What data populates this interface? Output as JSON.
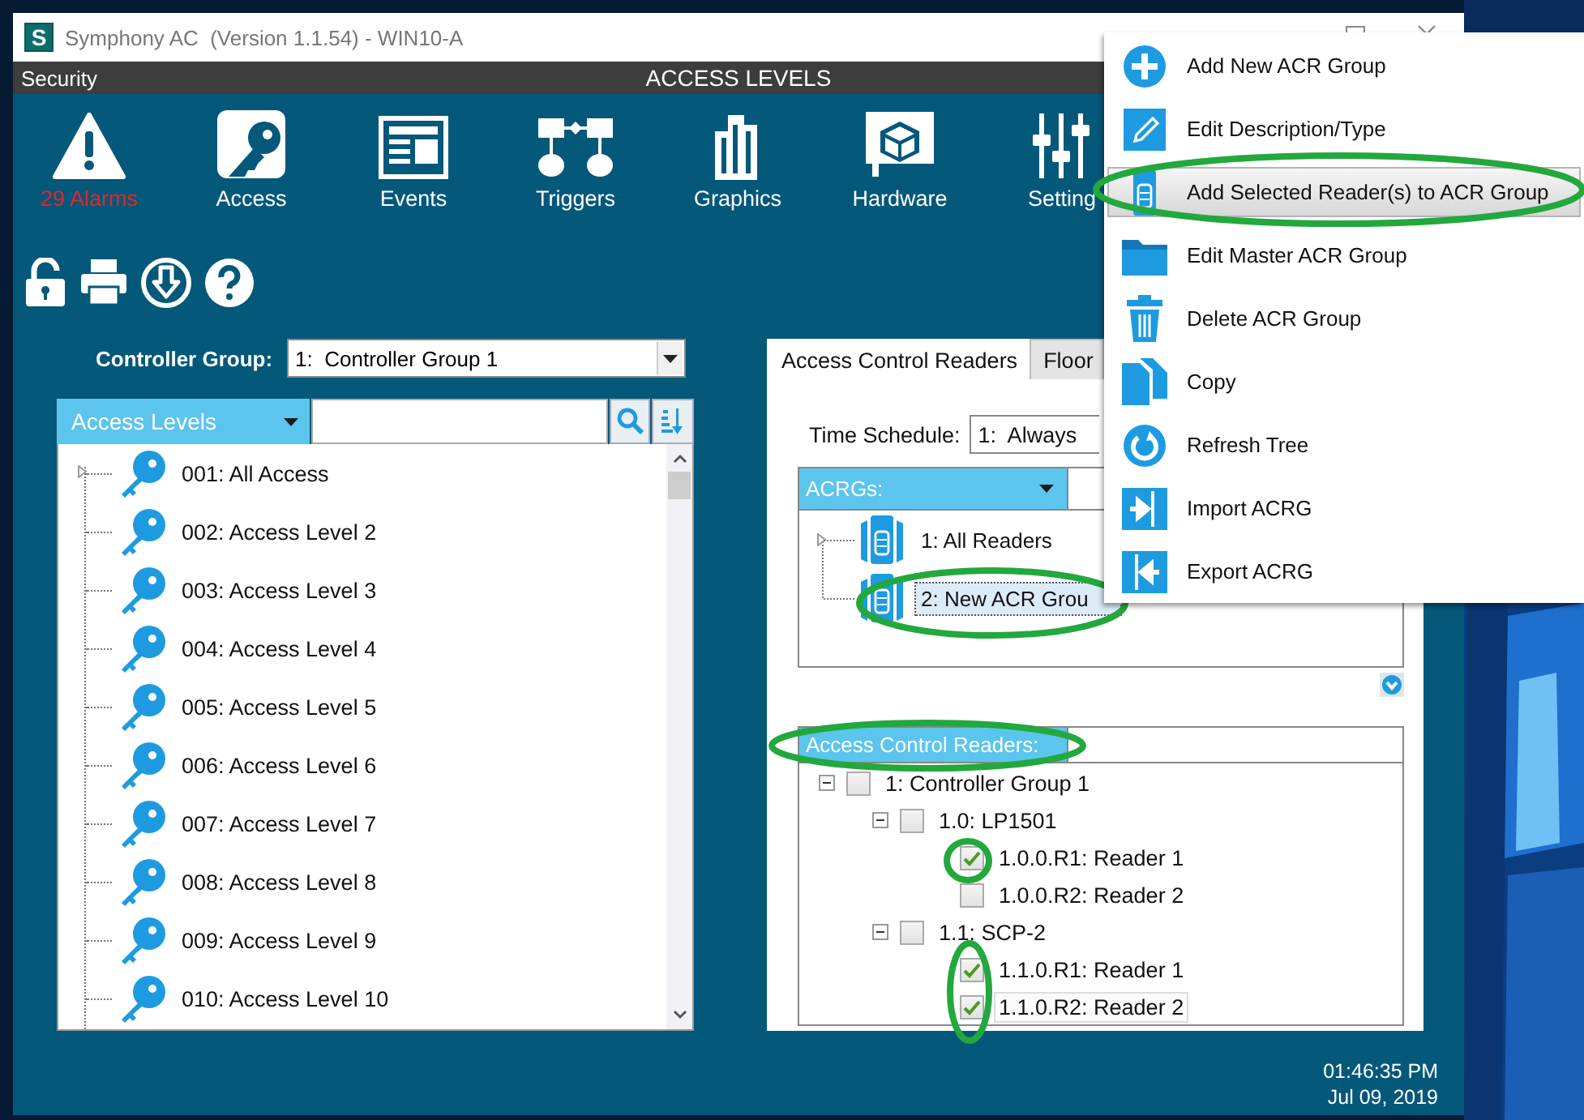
{
  "window": {
    "app_icon": "S",
    "title": "Symphony AC  (Version 1.1.54) - WIN10-A"
  },
  "header": {
    "section": "Security",
    "title": "ACCESS LEVELS"
  },
  "nav": [
    {
      "label": "29 Alarms",
      "kind": "alarms",
      "alert": true
    },
    {
      "label": "Access",
      "kind": "access",
      "alert": false
    },
    {
      "label": "Events",
      "kind": "events",
      "alert": false
    },
    {
      "label": "Triggers",
      "kind": "triggers",
      "alert": false
    },
    {
      "label": "Graphics",
      "kind": "graphics",
      "alert": false
    },
    {
      "label": "Hardware",
      "kind": "hardware",
      "alert": false
    },
    {
      "label": "Setting",
      "kind": "settings",
      "alert": false
    }
  ],
  "controller_group": {
    "label": "Controller Group:",
    "value": "1:  Controller Group 1"
  },
  "access_levels": {
    "dropdown": "Access Levels",
    "items": [
      {
        "label": "001: All Access",
        "selected": false
      },
      {
        "label": "002: Access Level 2",
        "selected": false
      },
      {
        "label": "003: Access Level 3",
        "selected": false
      },
      {
        "label": "004: Access Level 4",
        "selected": false
      },
      {
        "label": "005: Access Level 5",
        "selected": false
      },
      {
        "label": "006: Access Level 6",
        "selected": false
      },
      {
        "label": "007: Access Level 7",
        "selected": false
      },
      {
        "label": "008: Access Level 8",
        "selected": false
      },
      {
        "label": "009: Access Level 9",
        "selected": false
      },
      {
        "label": "010: Access Level 10",
        "selected": false
      }
    ]
  },
  "readers_panel": {
    "tabs": [
      {
        "label": "Access Control Readers",
        "selected": true
      },
      {
        "label": "Floor",
        "selected": false
      }
    ],
    "time_schedule": {
      "label": "Time Schedule:",
      "value": "1:  Always"
    },
    "acrgs": {
      "dropdown": "ACRGs:",
      "items": [
        {
          "label": "1: All Readers",
          "selected": false
        },
        {
          "label": "2: New ACR Grou",
          "selected": true
        }
      ]
    },
    "readers": {
      "header": "Access Control Readers:",
      "nodes": [
        {
          "label": "1:  Controller Group 1",
          "checked": false,
          "expanded": true,
          "selected": false,
          "children": [
            {
              "label": "1.0:  LP1501",
              "checked": false,
              "expanded": true,
              "selected": false,
              "children": [
                {
                  "label": "1.0.0.R1: Reader 1",
                  "checked": true,
                  "selected": false
                },
                {
                  "label": "1.0.0.R2: Reader 2",
                  "checked": false,
                  "selected": false
                }
              ]
            },
            {
              "label": "1.1:  SCP-2",
              "checked": false,
              "expanded": true,
              "selected": false,
              "children": [
                {
                  "label": "1.1.0.R1: Reader 1",
                  "checked": true,
                  "selected": false
                },
                {
                  "label": "1.1.0.R2: Reader 2",
                  "checked": true,
                  "selected": true
                }
              ]
            }
          ]
        }
      ]
    }
  },
  "clock": {
    "time": "01:46:35 PM",
    "date": "Jul 09, 2019"
  },
  "context_menu": {
    "items": [
      {
        "label": "Add New ACR Group",
        "kind": "add",
        "selected": false
      },
      {
        "label": "Edit Description/Type",
        "kind": "edit",
        "selected": false
      },
      {
        "label": "Add Selected Reader(s) to ACR Group",
        "kind": "add-readers",
        "selected": true
      },
      {
        "label": "Edit Master ACR Group",
        "kind": "folder",
        "selected": false
      },
      {
        "label": "Delete ACR Group",
        "kind": "delete",
        "selected": false
      },
      {
        "label": "Copy",
        "kind": "copy",
        "selected": false
      },
      {
        "label": "Refresh Tree",
        "kind": "refresh",
        "selected": false
      },
      {
        "label": "Import ACRG",
        "kind": "import",
        "selected": false
      },
      {
        "label": "Export ACRG",
        "kind": "export",
        "selected": false
      }
    ]
  }
}
